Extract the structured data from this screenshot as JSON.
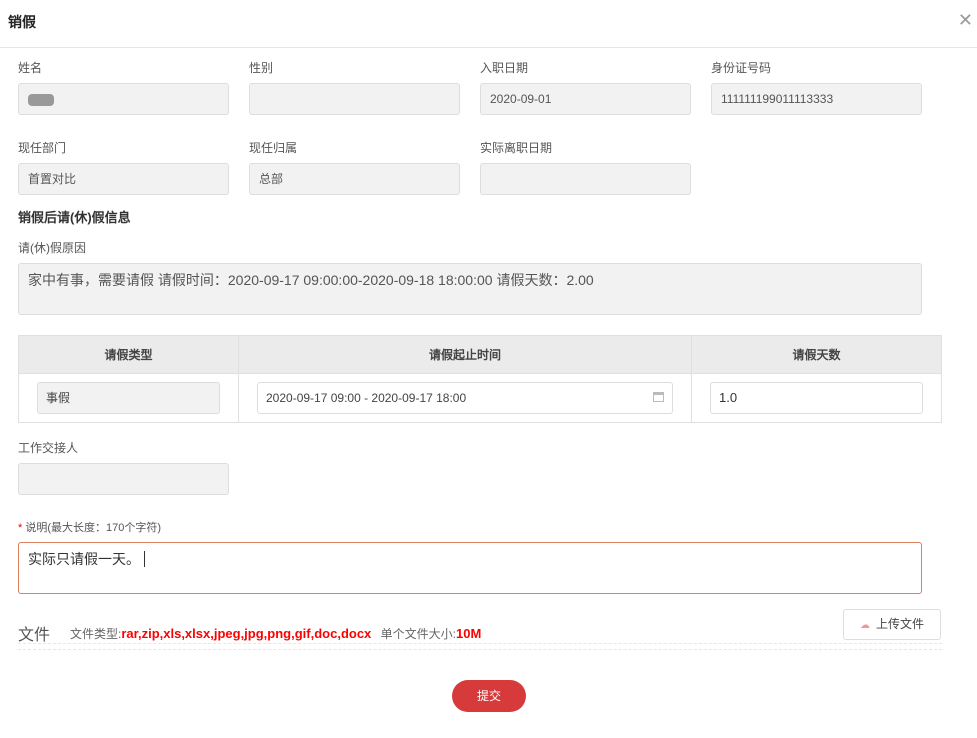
{
  "dialog": {
    "title": "销假",
    "close": "✕"
  },
  "fields": {
    "name": {
      "label": "姓名",
      "value": ""
    },
    "gender": {
      "label": "性别",
      "value": ""
    },
    "hire_date": {
      "label": "入职日期",
      "value": "2020-09-01"
    },
    "id_number": {
      "label": "身份证号码",
      "value": "111111199011113333"
    },
    "department": {
      "label": "现任部门",
      "value": "首置对比"
    },
    "affiliation": {
      "label": "现任归属",
      "value": "总部"
    },
    "leave_date": {
      "label": "实际离职日期",
      "value": ""
    }
  },
  "section_title": "销假后请(休)假信息",
  "reason": {
    "label": "请(休)假原因",
    "value": "家中有事，需要请假  请假时间：2020-09-17 09:00:00-2020-09-18 18:00:00  请假天数：2.00"
  },
  "table": {
    "headers": [
      "请假类型",
      "请假起止时间",
      "请假天数"
    ],
    "row": {
      "type": "事假",
      "range": "2020-09-17 09:00 - 2020-09-17 18:00",
      "days": "1.0"
    }
  },
  "handover": {
    "label": "工作交接人",
    "value": ""
  },
  "note": {
    "required": "*",
    "label": "说明(最大长度：170个字符)",
    "value": "实际只请假一天。"
  },
  "files": {
    "title": "文件",
    "types_label": "文件类型:",
    "types": "rar,zip,xls,xlsx,jpeg,jpg,png,gif,doc,docx",
    "size_label": "单个文件大小:",
    "size": "10M",
    "upload": "上传文件"
  },
  "submit": "提交",
  "colors": {
    "accent": "#d63a3a",
    "highlight": "#ff0000"
  }
}
